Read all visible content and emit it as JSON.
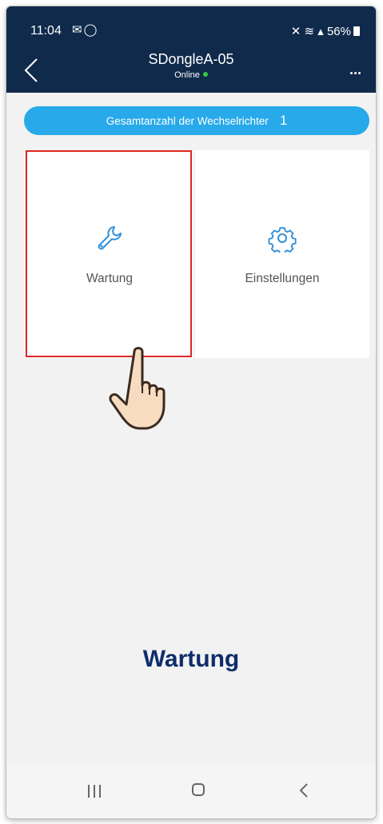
{
  "status_bar": {
    "time": "11:04",
    "battery": "56%"
  },
  "header": {
    "title": "SDongleA-05",
    "status": "Online"
  },
  "inverter_count": {
    "label": "Gesamtanzahl der Wechselrichter",
    "value": "1"
  },
  "tiles": [
    {
      "label": "Wartung",
      "icon": "wrench-icon"
    },
    {
      "label": "Einstellungen",
      "icon": "gear-icon"
    }
  ],
  "caption": "Wartung",
  "colors": {
    "header_bg": "#102a4c",
    "count_bar": "#27a9ea",
    "icon_blue": "#2f8fd8",
    "highlight": "#e02525",
    "caption": "#0e2d6b"
  }
}
